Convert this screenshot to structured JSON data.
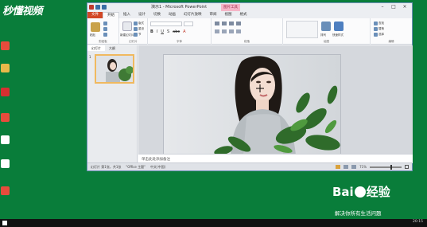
{
  "desktop": {
    "logo_text": "秒懂视频",
    "icons": [
      {
        "name": "app",
        "color": "#e74c3c",
        "label": "",
        "label_top": 0
      },
      {
        "name": "folder",
        "color": "#e8b94a",
        "label": "",
        "label_top": 0
      },
      {
        "name": "app2",
        "color": "#d63031",
        "label": "",
        "label_top": 0
      },
      {
        "name": "file",
        "color": "#ffffff",
        "label": "",
        "label_top": 0
      },
      {
        "name": "file2",
        "color": "#ffffff",
        "label": "",
        "label_top": 0
      },
      {
        "name": "app3",
        "color": "#e74c3c",
        "label": "",
        "label_top": 0
      }
    ]
  },
  "window": {
    "title": "演示1 - Microsoft PowerPoint",
    "context_tab": "图片工具",
    "controls": {
      "minimize": "–",
      "maximize": "□",
      "close": "×"
    },
    "tabs": [
      "文件",
      "开始",
      "插入",
      "设计",
      "切换",
      "动画",
      "幻灯片放映",
      "审阅",
      "视图",
      "格式"
    ],
    "ribbon_groups": [
      {
        "label": "剪贴板"
      },
      {
        "label": "幻灯片"
      },
      {
        "label": "字体"
      },
      {
        "label": "段落"
      },
      {
        "label": "绘图"
      },
      {
        "label": "编辑"
      }
    ],
    "ribbon_buttons": {
      "paste": "粘贴",
      "new_slide": "新建幻灯片",
      "layout": "版式",
      "reset": "重设",
      "section": "节",
      "arrange": "排列",
      "quick_styles": "快速样式",
      "find": "查找",
      "replace": "替换",
      "select": "选择"
    }
  },
  "left_pane": {
    "tabs": [
      "幻灯片",
      "大纲"
    ],
    "slide_number": "1"
  },
  "notes_placeholder": "单击此处添加备注",
  "status": {
    "slide_info": "幻灯片 第1张，共1张",
    "theme": "\"Office 主题\"",
    "language": "中文(中国)",
    "zoom": "71%"
  },
  "watermark": {
    "brand": "Bai",
    "brand2": "经验",
    "slogan": "解决你所有生活问题"
  },
  "taskbar": {
    "time": "20:15"
  }
}
